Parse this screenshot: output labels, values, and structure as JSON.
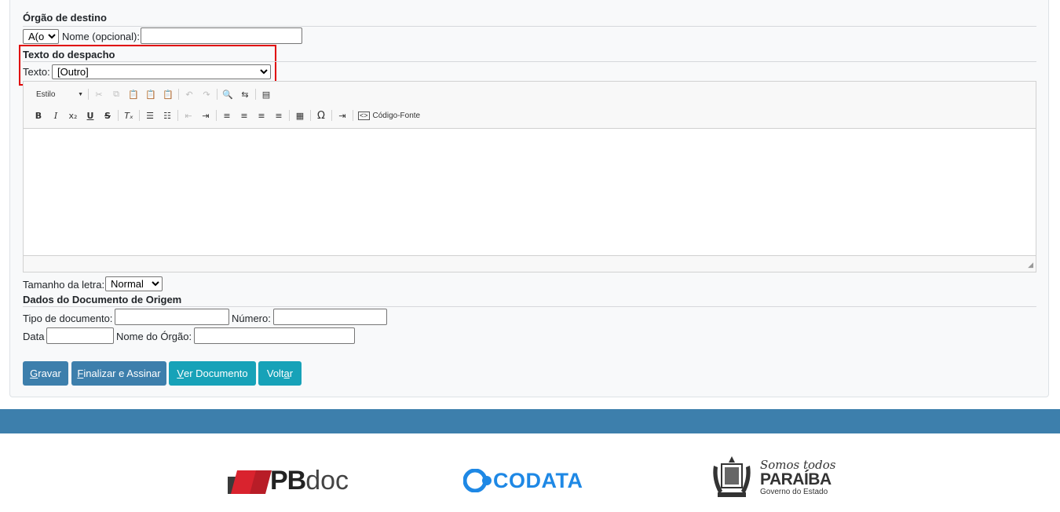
{
  "orgao": {
    "title": "Órgão de destino",
    "tratamento_value": "A(o)",
    "nome_label": "Nome (opcional):",
    "nome_value": ""
  },
  "despacho": {
    "title": "Texto do despacho",
    "texto_label": "Texto:",
    "texto_value": "[Outro]"
  },
  "editor": {
    "style_label": "Estilo",
    "source_label": "Código-Fonte",
    "content": ""
  },
  "font_size": {
    "label": "Tamanho da letra:",
    "value": "Normal"
  },
  "origem": {
    "title": "Dados do Documento de Origem",
    "tipo_label": "Tipo de documento:",
    "numero_label": "Número:",
    "data_label": "Data",
    "nome_orgao_label": "Nome do Órgão:"
  },
  "buttons": {
    "gravar_first": "G",
    "gravar_rest": "ravar",
    "finalizar_first": "F",
    "finalizar_rest": "inalizar e Assinar",
    "ver_first": "V",
    "ver_rest": "er Documento",
    "voltar_pre": "Volt",
    "voltar_u": "a",
    "voltar_post": "r"
  },
  "logos": {
    "pbdoc_pb": "PB",
    "pbdoc_doc": "doc",
    "codata": "CODATA",
    "paraiba_somos": "Somos todos",
    "paraiba_name": "PARAÍBA",
    "paraiba_gov": "Governo do Estado"
  },
  "colors": {
    "btn_primary": "#3d7fac",
    "btn_info": "#17a2b8",
    "footer": "#3d7fac",
    "highlight": "#e00000",
    "pbdoc_red": "#d9232e",
    "codata_blue": "#1e88e5"
  }
}
